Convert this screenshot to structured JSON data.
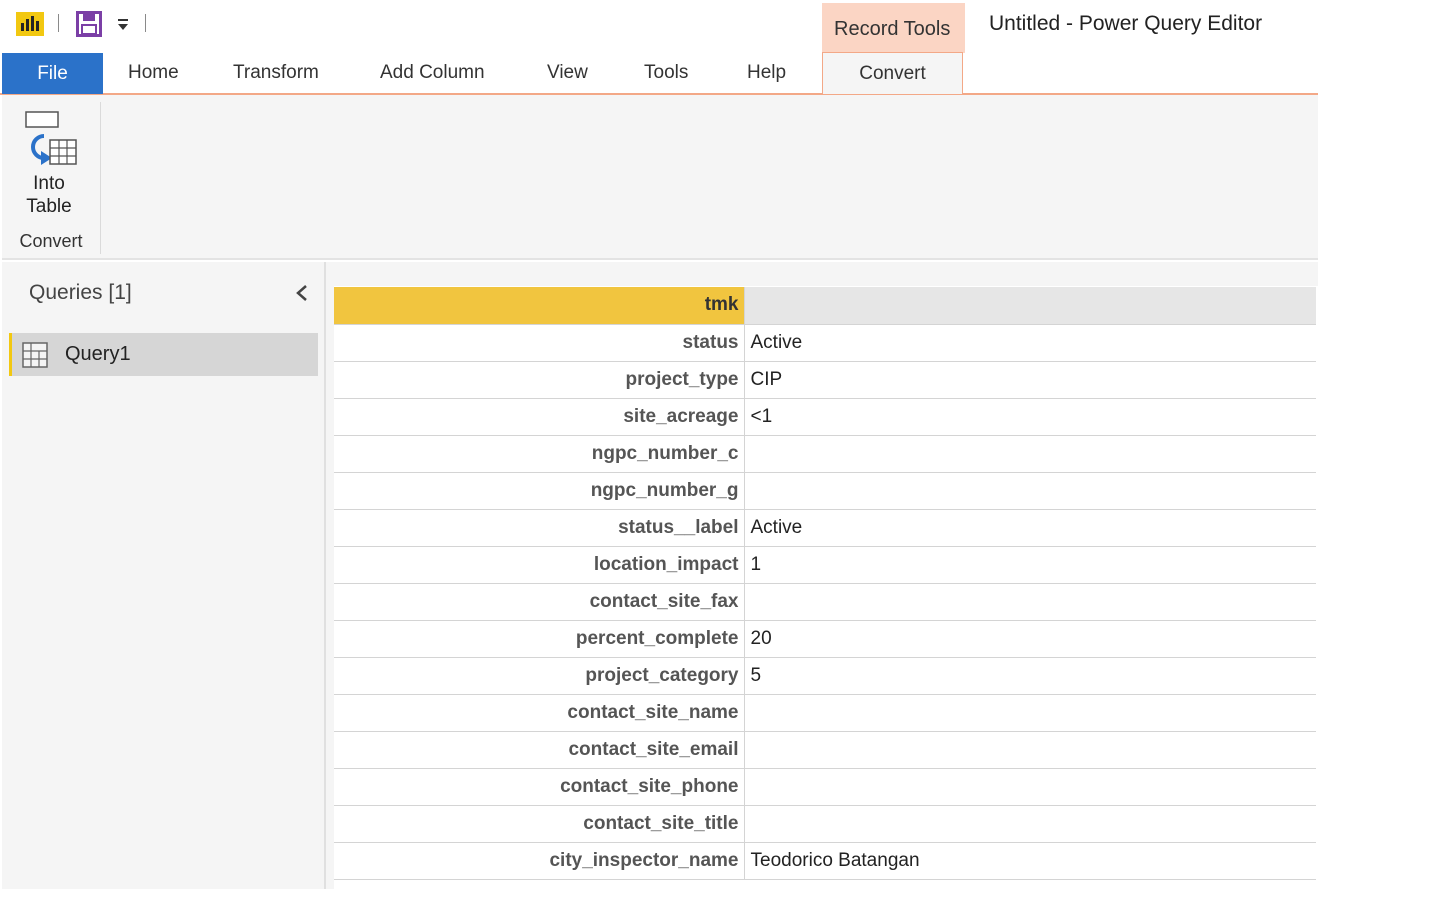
{
  "window": {
    "title": "Untitled - Power Query Editor",
    "context_group": "Record Tools"
  },
  "tabs": [
    "File",
    "Home",
    "Transform",
    "Add Column",
    "View",
    "Tools",
    "Help",
    "Convert"
  ],
  "active_tab": "Convert",
  "ribbon": {
    "into_table_line1": "Into",
    "into_table_line2": "Table",
    "group_label": "Convert"
  },
  "queries": {
    "title": "Queries [1]",
    "items": [
      {
        "label": "Query1"
      }
    ]
  },
  "record": {
    "header_field": "tmk",
    "header_value": "",
    "rows": [
      {
        "field": "status",
        "value": "Active"
      },
      {
        "field": "project_type",
        "value": "CIP"
      },
      {
        "field": "site_acreage",
        "value": "<1"
      },
      {
        "field": "ngpc_number_c",
        "value": ""
      },
      {
        "field": "ngpc_number_g",
        "value": ""
      },
      {
        "field": "status__label",
        "value": "Active"
      },
      {
        "field": "location_impact",
        "value": "1"
      },
      {
        "field": "contact_site_fax",
        "value": ""
      },
      {
        "field": "percent_complete",
        "value": "20"
      },
      {
        "field": "project_category",
        "value": "5"
      },
      {
        "field": "contact_site_name",
        "value": ""
      },
      {
        "field": "contact_site_email",
        "value": ""
      },
      {
        "field": "contact_site_phone",
        "value": ""
      },
      {
        "field": "contact_site_title",
        "value": ""
      },
      {
        "field": "city_inspector_name",
        "value": "Teodorico Batangan"
      }
    ]
  },
  "colors": {
    "file_tab": "#2b72c9",
    "context_tab": "#fbd5c4",
    "accent_line": "#f3a887",
    "record_header": "#f1c53f",
    "selection_bar": "#f2c811"
  },
  "icons": [
    "power-bi-icon",
    "save-icon",
    "customize-caret-icon",
    "into-table-icon",
    "collapse-chevron-icon",
    "table-icon"
  ]
}
